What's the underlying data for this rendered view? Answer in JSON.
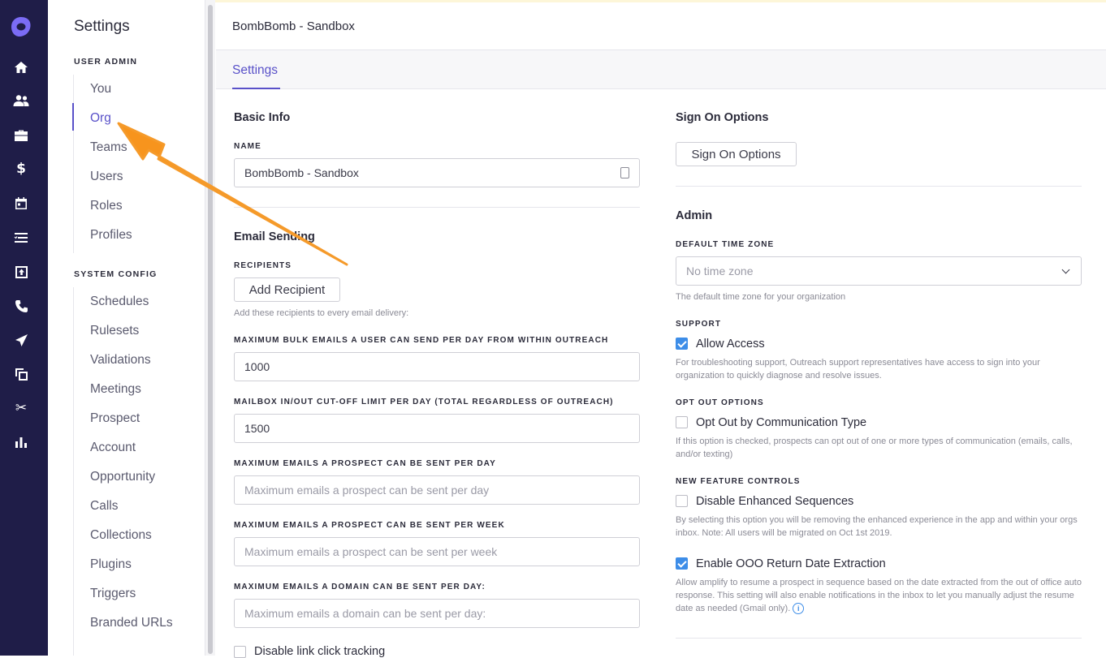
{
  "nav": {
    "title": "Settings",
    "sections": [
      {
        "label": "USER ADMIN",
        "items": [
          "You",
          "Org",
          "Teams",
          "Users",
          "Roles",
          "Profiles"
        ]
      },
      {
        "label": "SYSTEM CONFIG",
        "items": [
          "Schedules",
          "Rulesets",
          "Validations",
          "Meetings",
          "Prospect",
          "Account",
          "Opportunity",
          "Calls",
          "Collections",
          "Plugins",
          "Triggers",
          "Branded URLs"
        ]
      }
    ],
    "active": "Org"
  },
  "rail_icons": [
    "outreach-logo-icon",
    "home-icon",
    "people-icon",
    "briefcase-icon",
    "dollar-icon",
    "calendar-icon",
    "tasks-icon",
    "inbox-icon",
    "phone-icon",
    "send-icon",
    "copy-icon",
    "scissors-icon",
    "bar-chart-icon"
  ],
  "header": {
    "org_name": "BombBomb - Sandbox",
    "tab": "Settings"
  },
  "basic_info": {
    "heading": "Basic Info",
    "name_label": "NAME",
    "name_value": "BombBomb - Sandbox"
  },
  "email_sending": {
    "heading": "Email Sending",
    "recipients_label": "RECIPIENTS",
    "add_recipient": "Add Recipient",
    "recipients_hint": "Add these recipients to every email delivery:",
    "bulk_label": "MAXIMUM BULK EMAILS A USER CAN SEND PER DAY FROM WITHIN OUTREACH",
    "bulk_value": "1000",
    "mailbox_label": "MAILBOX IN/OUT CUT-OFF LIMIT PER DAY (TOTAL REGARDLESS OF OUTREACH)",
    "mailbox_value": "1500",
    "prospect_day_label": "MAXIMUM EMAILS A PROSPECT CAN BE SENT PER DAY",
    "prospect_day_placeholder": "Maximum emails a prospect can be sent per day",
    "prospect_week_label": "MAXIMUM EMAILS A PROSPECT CAN BE SENT PER WEEK",
    "prospect_week_placeholder": "Maximum emails a prospect can be sent per week",
    "domain_day_label": "MAXIMUM EMAILS A DOMAIN CAN BE SENT PER DAY:",
    "domain_day_placeholder": "Maximum emails a domain can be sent per day:",
    "disable_link_tracking": "Disable link click tracking"
  },
  "sign_on": {
    "heading": "Sign On Options",
    "button": "Sign On Options"
  },
  "admin": {
    "heading": "Admin",
    "tz_label": "DEFAULT TIME ZONE",
    "tz_value": "No time zone",
    "tz_hint": "The default time zone for your organization",
    "support_label": "SUPPORT",
    "allow_access": "Allow Access",
    "allow_access_checked": true,
    "support_hint": "For troubleshooting support, Outreach support representatives have access to sign into your organization to quickly diagnose and resolve issues.",
    "optout_label": "OPT OUT OPTIONS",
    "optout_option": "Opt Out by Communication Type",
    "optout_checked": false,
    "optout_hint": "If this option is checked, prospects can opt out of one or more types of communication (emails, calls, and/or texting)",
    "feature_label": "NEW FEATURE CONTROLS",
    "disable_enhanced": "Disable Enhanced Sequences",
    "disable_enhanced_checked": false,
    "disable_enhanced_hint": "By selecting this option you will be removing the enhanced experience in the app and within your orgs inbox. Note: All users will be migrated on Oct 1st 2019.",
    "ooo": "Enable OOO Return Date Extraction",
    "ooo_checked": true,
    "ooo_hint": "Allow amplify to resume a prospect in sequence based on the date extracted from the out of office auto response. This setting will also enable notifications in the inbox to let you manually adjust the resume date as needed (Gmail only)."
  },
  "colors": {
    "rail": "#1f1d48",
    "accent": "#5951c9",
    "checkbox": "#3d8de8",
    "annotation_arrow": "#f7941d"
  }
}
